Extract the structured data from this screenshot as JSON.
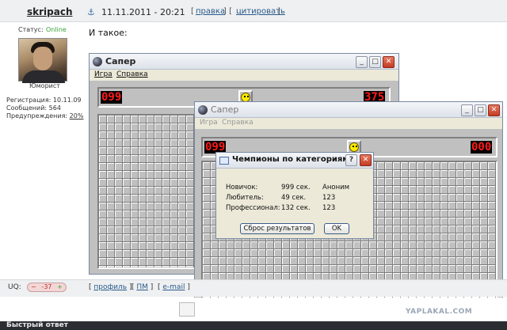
{
  "post": {
    "username": "skripach",
    "datetime": "11.11.2011 - 20:21",
    "links": [
      "[",
      "правка",
      "] [",
      "цитировать",
      "]"
    ],
    "text": "И такое:"
  },
  "user": {
    "status_label": "Статус:",
    "status_value": "Online",
    "rank": "Юморист",
    "registration": "Регистрация: 10.11.09",
    "messages": "Сообщений: 564",
    "warnings_prefix": "Предупреждения: ",
    "warnings_value": "20%"
  },
  "uq": {
    "label": "UQ:",
    "minus": "−",
    "value": "-37",
    "plus": "+"
  },
  "footer_links": {
    "profile": "профиль",
    "pm": "ПМ",
    "email": "e-mail"
  },
  "quick_reply": "Быстрый ответ",
  "watermark": "YAPLAKAL.COM",
  "windows": {
    "back": {
      "title": "Сапер",
      "menu": [
        "Игра",
        "Справка"
      ],
      "mines_counter": "099",
      "timer": "375"
    },
    "front": {
      "title": "Сапер",
      "menu": [
        "Игра",
        "Справка"
      ],
      "mines_counter": "099",
      "timer": "000"
    }
  },
  "dialog": {
    "title": "Чемпионы по категориям",
    "help_button": "?",
    "close_button": "✕",
    "rows": [
      {
        "category": "Новичок:",
        "time": "999 сек.",
        "name": "Аноним"
      },
      {
        "category": "Любитель:",
        "time": "49 сек.",
        "name": "123"
      },
      {
        "category": "Профессионал:",
        "time": "132 сек.",
        "name": "123"
      }
    ],
    "reset_button": "Сброс результатов",
    "ok_button": "OK"
  },
  "icons": {
    "anchor": "anchor-icon",
    "app": "minesweeper-icon",
    "smiley": "smiley-face-icon"
  }
}
